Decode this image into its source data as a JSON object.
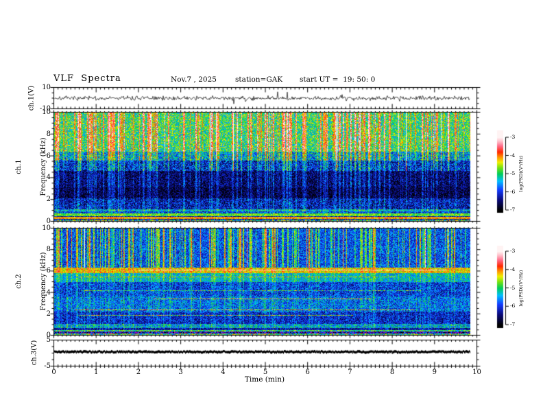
{
  "header": {
    "title": "VLF  Spectra",
    "date": "Nov.7 , 2025",
    "station": "station=GAK",
    "start_ut": "start UT =  19: 50: 0"
  },
  "xaxis": {
    "label": "Time (min)",
    "ticks": [
      "0",
      "1",
      "2",
      "3",
      "4",
      "5",
      "6",
      "7",
      "8",
      "9",
      "10"
    ],
    "range": [
      0,
      10
    ]
  },
  "panels": [
    {
      "id": "ch1-voltage",
      "ylabel": "ch.1(V)",
      "yticks": [
        "10",
        "-10"
      ],
      "ylim": [
        -10,
        10
      ]
    },
    {
      "id": "ch1-spectrogram",
      "ylabel_line1": "ch.1",
      "ylabel_line2": "Frequency (kHz)",
      "yticks": [
        "0",
        "2",
        "4",
        "6",
        "8",
        "10"
      ],
      "ylim": [
        0,
        10
      ]
    },
    {
      "id": "ch2-spectrogram",
      "ylabel_line1": "ch.2",
      "ylabel_line2": "Frequency (kHz)",
      "yticks": [
        "0",
        "2",
        "4",
        "6",
        "8",
        "10"
      ],
      "ylim": [
        0,
        10
      ]
    },
    {
      "id": "ch3-voltage",
      "ylabel": "ch.3(V)",
      "yticks": [
        "5",
        "-5"
      ],
      "ylim": [
        -5,
        5
      ]
    }
  ],
  "colorbars": [
    {
      "label": "log(PSD)(V²/Hz)",
      "ticks": [
        "-3",
        "-4",
        "-5",
        "-6",
        "-7"
      ],
      "range": [
        -7,
        -3
      ]
    },
    {
      "label": "log(PSD)(V²/Hz)",
      "ticks": [
        "-3",
        "-4",
        "-5",
        "-6",
        "-7"
      ],
      "range": [
        -7,
        -3
      ]
    }
  ],
  "chart_data": [
    {
      "type": "line",
      "name": "ch1-voltage-trace",
      "ylabel": "ch.1(V)",
      "xlim": [
        0,
        10
      ],
      "ylim": [
        -10,
        10
      ],
      "summary": "continuous noisy waveform centered on 0 V, typical excursions ±3 V with sporadic impulsive spikes to ±8 V, data span 0 to ~9.85 min",
      "gen": {
        "seed": 7,
        "amp": 2.0,
        "spike_prob": 0.02,
        "spike_amp": 14
      }
    },
    {
      "type": "heatmap",
      "name": "ch1-spectrogram",
      "xlabel": "Time (min)",
      "ylabel": "ch.1 Frequency (kHz)",
      "xlim": [
        0,
        10
      ],
      "ylim": [
        0,
        10
      ],
      "colorbar": {
        "label": "log(PSD)(V²/Hz)",
        "range": [
          -7,
          -3
        ],
        "ticks": [
          -3,
          -4,
          -5,
          -6,
          -7
        ]
      },
      "summary": "bright green impulsive vertical streaks above ~5.5 kHz (some red, log PSD up to -3.5); dark blue background -6.5 to -7 between 1 and 5.5 kHz crossed by thin cyan horizontal and vertical lines; strong orange/red band near 0.3 kHz (~-4) and yellow-green band near 0.5-0.7 kHz (~-4.8)",
      "gen": {
        "seed": 11,
        "bands": [
          [
            0.0,
            0.12,
            -5.2,
            1.2,
            0.2,
            0.0,
            0
          ],
          [
            0.12,
            0.22,
            -6.5,
            0.6,
            0.2,
            0.0,
            0
          ],
          [
            0.22,
            0.38,
            -4.15,
            0.5,
            0.1,
            0.0,
            0
          ],
          [
            0.38,
            0.47,
            -6.2,
            0.6,
            0.1,
            0.0,
            0
          ],
          [
            0.47,
            0.72,
            -4.75,
            0.45,
            0.1,
            0.0,
            0
          ],
          [
            0.72,
            0.88,
            -5.9,
            0.7,
            0.2,
            0.0,
            0
          ],
          [
            0.88,
            1.1,
            -5.4,
            0.7,
            0.3,
            0.0,
            0
          ],
          [
            1.1,
            2.1,
            -6.25,
            0.7,
            0.35,
            0.3,
            0
          ],
          [
            2.1,
            3.1,
            -6.7,
            0.55,
            0.4,
            0.35,
            0
          ],
          [
            3.1,
            4.6,
            -6.55,
            0.6,
            0.45,
            0.35,
            0
          ],
          [
            4.6,
            5.6,
            -6.1,
            0.75,
            0.6,
            0.3,
            0
          ],
          [
            5.6,
            6.4,
            -5.5,
            0.8,
            0.85,
            0.1,
            0
          ],
          [
            6.4,
            10.01,
            -4.95,
            0.7,
            1.0,
            0.0,
            0
          ]
        ],
        "streaks": {
          "count": 190,
          "smin": 0.5,
          "smax": 1.8
        },
        "red_streaks": {
          "count": 14,
          "smin": 1.6,
          "smax": 2.6
        }
      }
    },
    {
      "type": "heatmap",
      "name": "ch2-spectrogram",
      "xlabel": "Time (min)",
      "ylabel": "ch.2 Frequency (kHz)",
      "xlim": [
        0,
        10
      ],
      "ylim": [
        0,
        10
      ],
      "colorbar": {
        "label": "log(PSD)(V²/Hz)",
        "range": [
          -7,
          -3
        ],
        "ticks": [
          -3,
          -4,
          -5,
          -6,
          -7
        ]
      },
      "summary": "blue background above 6.3 kHz with dense green vertical streaks; strong orange/yellow horizontal band at ~6 kHz (~-4.3); bright cyan band 5-5.8 kHz; striped cyan/blue region 2.2-3.6 kHz; darker blue 1-2.2 kHz; green and purple-speckled bands below 1 kHz",
      "gen": {
        "seed": 29,
        "bands": [
          [
            0.0,
            0.1,
            -5.0,
            1.0,
            0.15,
            0.0,
            0
          ],
          [
            0.1,
            0.3,
            -6.4,
            0.9,
            0.15,
            0.0,
            1
          ],
          [
            0.3,
            0.42,
            -5.0,
            0.6,
            0.15,
            0.0,
            0
          ],
          [
            0.42,
            0.62,
            -6.3,
            0.6,
            0.15,
            0.0,
            0
          ],
          [
            0.62,
            1.05,
            -5.45,
            0.7,
            0.2,
            0.2,
            0
          ],
          [
            1.05,
            2.2,
            -6.15,
            0.6,
            0.25,
            0.35,
            0
          ],
          [
            2.2,
            3.6,
            -5.75,
            0.65,
            0.3,
            0.5,
            0
          ],
          [
            3.6,
            5.0,
            -6.0,
            0.65,
            0.3,
            0.4,
            0
          ],
          [
            5.0,
            5.8,
            -5.35,
            0.55,
            0.35,
            0.3,
            0
          ],
          [
            5.8,
            6.3,
            -4.35,
            0.5,
            0.3,
            0.2,
            0
          ],
          [
            6.3,
            10.01,
            -5.85,
            0.6,
            1.0,
            0.0,
            0
          ]
        ],
        "streaks": {
          "count": 170,
          "smin": 0.5,
          "smax": 1.7
        },
        "red_streaks": {
          "count": 8,
          "smin": 1.4,
          "smax": 2.2
        }
      }
    },
    {
      "type": "line",
      "name": "ch3-voltage-trace",
      "ylabel": "ch.3(V)",
      "xlim": [
        0,
        10
      ],
      "ylim": [
        -5,
        5
      ],
      "summary": "thick flat noisy black trace at ≈ +0.5 V across the whole record, ending near 9.85 min",
      "gen": {
        "seed": 3,
        "level": 0.55,
        "jitter": 0.5
      }
    }
  ]
}
